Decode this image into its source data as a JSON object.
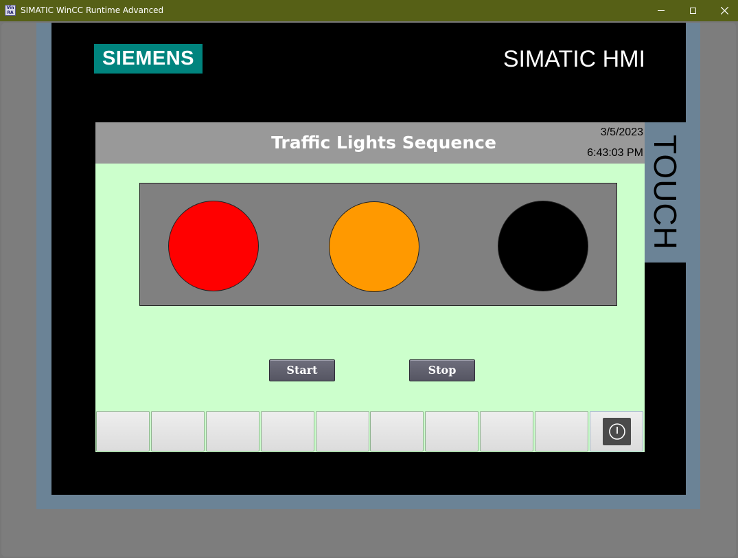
{
  "window": {
    "title": "SIMATIC WinCC Runtime Advanced",
    "icon_text_top": "Vin",
    "icon_text_bottom": "RA",
    "controls": [
      "minimize-icon",
      "maximize-icon",
      "close-icon"
    ]
  },
  "device": {
    "brand": "SIEMENS",
    "model_label": "SIMATIC HMI",
    "side_label": "TOUCH",
    "brand_color": "#00847e",
    "bezel_color": "#6b8396"
  },
  "screen": {
    "title": "Traffic Lights Sequence",
    "date": "3/5/2023",
    "time": "6:43:03 PM",
    "background_color": "#ccffcc",
    "header_color": "#999999"
  },
  "traffic_lights": [
    {
      "name": "red",
      "state": "on",
      "color": "#ff0000"
    },
    {
      "name": "amber",
      "state": "on",
      "color": "#ff9900"
    },
    {
      "name": "green",
      "state": "off",
      "color": "#000000"
    }
  ],
  "buttons": {
    "start_label": "Start",
    "stop_label": "Stop"
  },
  "function_keys": {
    "count": 10,
    "last_key_icon": "power-icon"
  }
}
